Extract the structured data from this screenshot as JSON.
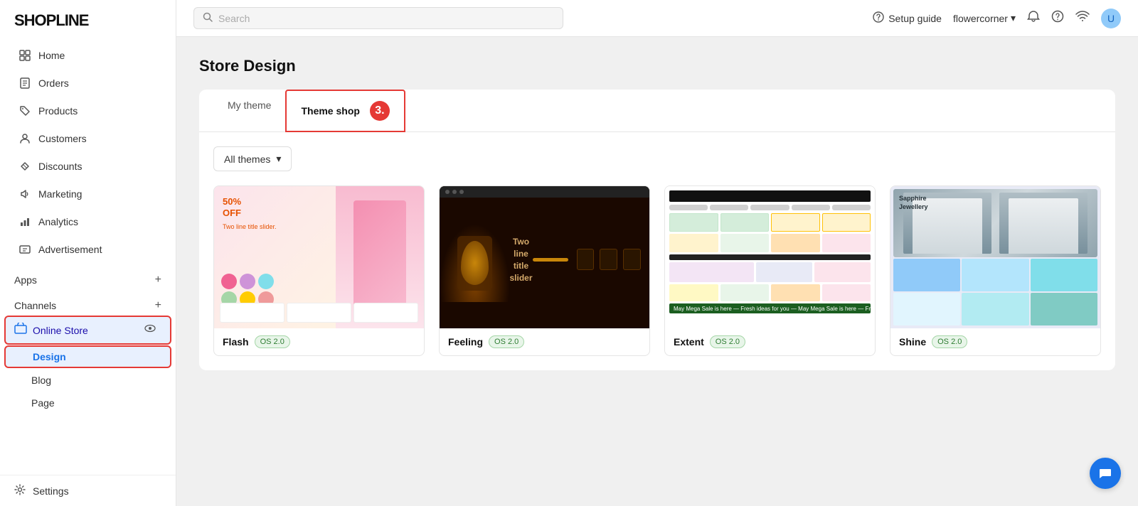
{
  "app": {
    "logo": "SHOPLINE"
  },
  "topbar": {
    "search_placeholder": "Search",
    "setup_guide_label": "Setup guide",
    "store_name": "flowercorner",
    "chevron": "▾"
  },
  "sidebar": {
    "nav_items": [
      {
        "id": "home",
        "label": "Home",
        "icon": "grid-icon"
      },
      {
        "id": "orders",
        "label": "Orders",
        "icon": "receipt-icon"
      },
      {
        "id": "products",
        "label": "Products",
        "icon": "tag-icon"
      },
      {
        "id": "customers",
        "label": "Customers",
        "icon": "person-icon"
      },
      {
        "id": "discounts",
        "label": "Discounts",
        "icon": "discount-icon"
      },
      {
        "id": "marketing",
        "label": "Marketing",
        "icon": "megaphone-icon"
      },
      {
        "id": "analytics",
        "label": "Analytics",
        "icon": "chart-icon"
      },
      {
        "id": "advertisement",
        "label": "Advertisement",
        "icon": "ad-icon"
      }
    ],
    "apps_label": "Apps",
    "channels_label": "Channels",
    "online_store_label": "Online Store",
    "design_label": "Design",
    "blog_label": "Blog",
    "page_label": "Page",
    "settings_label": "Settings"
  },
  "page": {
    "title": "Store Design",
    "step_badge": "3."
  },
  "tabs": [
    {
      "id": "my-theme",
      "label": "My theme"
    },
    {
      "id": "theme-shop",
      "label": "Theme shop"
    }
  ],
  "filter": {
    "all_themes_label": "All themes",
    "chevron": "▾"
  },
  "themes": [
    {
      "id": "flash",
      "name": "Flash",
      "badge": "OS 2.0",
      "preview_type": "flash"
    },
    {
      "id": "feeling",
      "name": "Feeling",
      "badge": "OS 2.0",
      "preview_type": "feeling"
    },
    {
      "id": "extent",
      "name": "Extent",
      "badge": "OS 2.0",
      "preview_type": "extent"
    },
    {
      "id": "shine",
      "name": "Shine",
      "badge": "OS 2.0",
      "preview_type": "shine"
    }
  ],
  "chat_button": {
    "icon": "💬"
  }
}
